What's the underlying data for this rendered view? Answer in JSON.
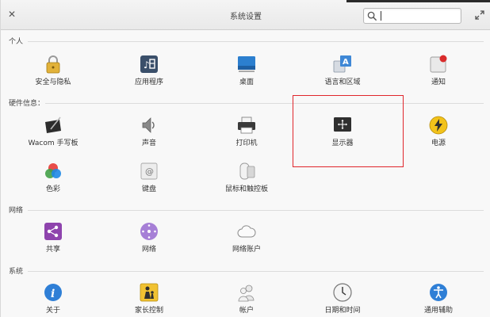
{
  "window": {
    "title": "系统设置"
  },
  "search": {
    "placeholder": "",
    "value": ""
  },
  "sections": {
    "personal": "个人",
    "hardware": "硬件信息：",
    "network": "网络",
    "system": "系统"
  },
  "items": {
    "security": "安全与隐私",
    "applications": "应用程序",
    "desktop": "桌面",
    "language": "语言和区域",
    "notifications": "通知",
    "wacom": "Wacom 手写板",
    "sound": "声音",
    "printers": "打印机",
    "displays": "显示器",
    "power": "电源",
    "color": "色彩",
    "keyboard": "键盘",
    "mouse": "鼠标和触控板",
    "sharing": "共享",
    "network": "网络",
    "online_accounts": "网络账户",
    "about": "关于",
    "parental": "家长控制",
    "users": "帐户",
    "datetime": "日期和时间",
    "accessibility": "通用辅助"
  }
}
